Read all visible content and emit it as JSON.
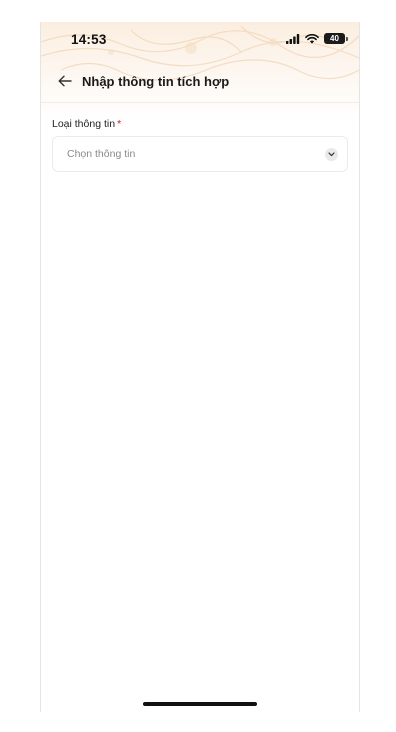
{
  "status_bar": {
    "time": "14:53",
    "battery_level": "40",
    "icons": [
      "signal-icon",
      "wifi-icon",
      "battery-icon"
    ]
  },
  "nav": {
    "back_icon": "arrow-left-icon",
    "title": "Nhập thông tin tích hợp"
  },
  "form": {
    "field_label": "Loại thông tin",
    "required_mark": "*",
    "select_placeholder": "Chọn thông tin",
    "select_icon": "chevron-down-icon"
  },
  "colors": {
    "header_tint": "#fbeee0",
    "required": "#d0192b",
    "placeholder": "#8a8a8a"
  }
}
